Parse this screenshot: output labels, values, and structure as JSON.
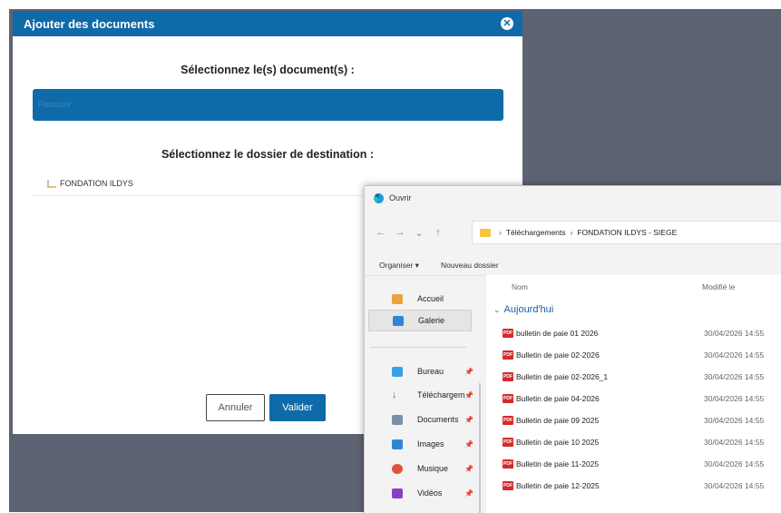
{
  "modal": {
    "title": "Ajouter des documents",
    "select_docs_label": "Sélectionnez le(s) document(s) :",
    "browse_label": "Parcourir",
    "select_dest_label": "Sélectionnez le dossier de destination :",
    "folder": "FONDATION ILDYS",
    "cancel_label": "Annuler",
    "validate_label": "Valider"
  },
  "file_dialog": {
    "title": "Ouvrir",
    "breadcrumb": [
      "Téléchargements",
      "FONDATION ILDYS - SIEGE"
    ],
    "toolbar": {
      "organize": "Organiser ▾",
      "new_folder": "Nouveau dossier"
    },
    "nav": [
      {
        "label": "Accueil",
        "icon": "home-icon"
      },
      {
        "label": "Galerie",
        "icon": "gallery-icon"
      },
      {
        "label": "Bureau",
        "icon": "desktop-icon"
      },
      {
        "label": "Téléchargem",
        "icon": "download-icon"
      },
      {
        "label": "Documents",
        "icon": "documents-icon"
      },
      {
        "label": "Images",
        "icon": "images-icon"
      },
      {
        "label": "Musique",
        "icon": "music-icon"
      },
      {
        "label": "Vidéos",
        "icon": "videos-icon"
      }
    ],
    "columns": {
      "name": "Nom",
      "modified": "Modifié le"
    },
    "group": "Aujourd'hui",
    "files": [
      {
        "name": "bulletin de paie 01 2026",
        "modified": "30/04/2026 14:55"
      },
      {
        "name": "Bulletin de paie 02-2026",
        "modified": "30/04/2026 14:55"
      },
      {
        "name": "Bulletin de paie 02-2026_1",
        "modified": "30/04/2026 14:55"
      },
      {
        "name": "Bulletin de paie 04-2026",
        "modified": "30/04/2026 14:55"
      },
      {
        "name": "Bulletin de paie 09 2025",
        "modified": "30/04/2026 14:55"
      },
      {
        "name": "Bulletin de paie 10 2025",
        "modified": "30/04/2026 14:55"
      },
      {
        "name": "Bulletin de paie 11-2025",
        "modified": "30/04/2026 14:55"
      },
      {
        "name": "Bulletin de paie 12-2025",
        "modified": "30/04/2026 14:55"
      }
    ]
  },
  "colors": {
    "primary": "#0f6aa9",
    "backdrop": "#5d6373",
    "pdf": "#d42b2b"
  }
}
